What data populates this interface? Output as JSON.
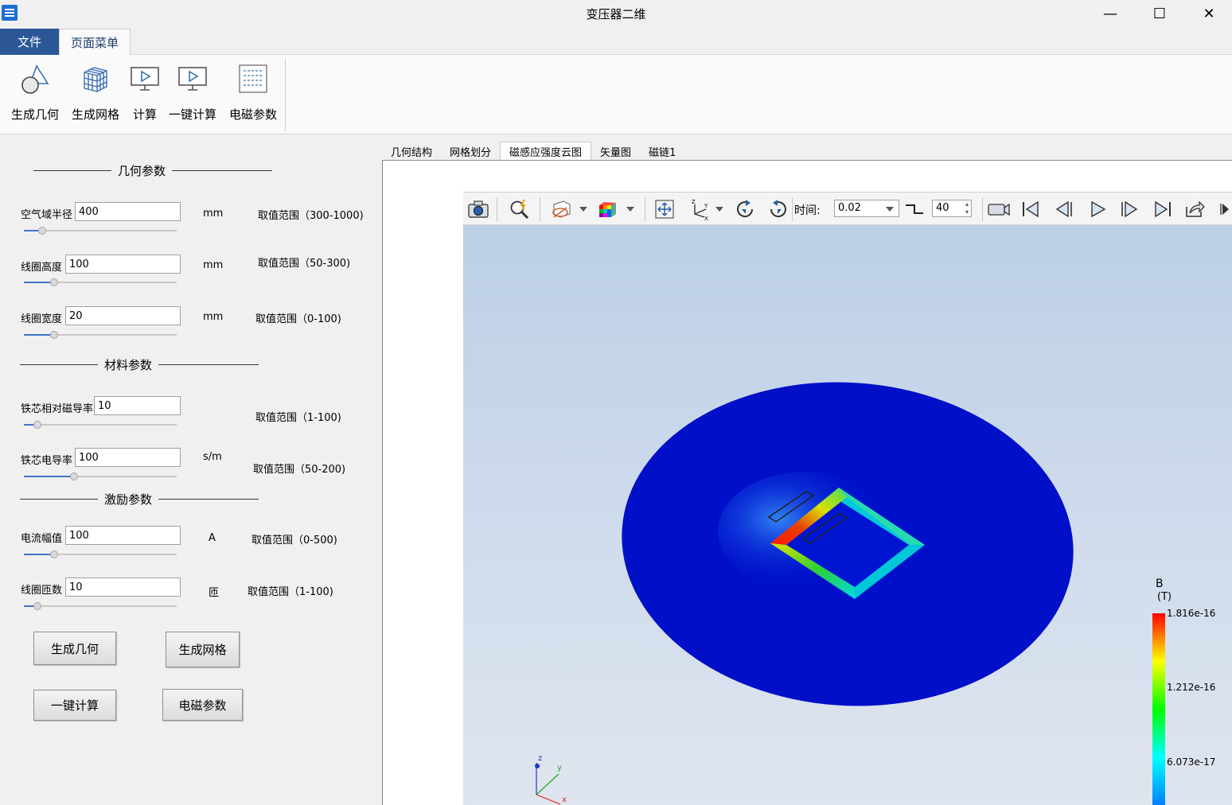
{
  "window": {
    "title": "变压器二维",
    "minimize": "—",
    "maximize": "☐",
    "close": "✕"
  },
  "menu": {
    "file": "文件",
    "page_menu": "页面菜单"
  },
  "ribbon": [
    {
      "label": "生成几何",
      "icon": "geometry-shapes-icon"
    },
    {
      "label": "生成网格",
      "icon": "mesh-cube-icon"
    },
    {
      "label": "计算",
      "icon": "compute-monitor-icon"
    },
    {
      "label": "一键计算",
      "icon": "one-click-compute-icon"
    },
    {
      "label": "电磁参数",
      "icon": "em-params-icon"
    }
  ],
  "panel": {
    "sections": {
      "geometry": "几何参数",
      "material": "材料参数",
      "excitation": "激励参数"
    },
    "params": [
      {
        "label": "空气域半径",
        "value": "400",
        "unit": "mm",
        "range": "取值范围（300-1000)",
        "slider_fraction": 0.12
      },
      {
        "label": "线圈高度",
        "value": "100",
        "unit": "mm",
        "range": "取值范围（50-300)",
        "slider_fraction": 0.2
      },
      {
        "label": "线圈宽度",
        "value": "20",
        "unit": "mm",
        "range": "取值范围（0-100)",
        "slider_fraction": 0.2
      },
      {
        "label": "铁芯相对磁导率",
        "value": "10",
        "unit": "",
        "range": "取值范围（1-100)",
        "slider_fraction": 0.09
      },
      {
        "label": "铁芯电导率",
        "value": "100",
        "unit": "s/m",
        "range": "取值范围（50-200)",
        "slider_fraction": 0.33
      },
      {
        "label": "电流幅值",
        "value": "100",
        "unit": "A",
        "range": "取值范围（0-500)",
        "slider_fraction": 0.2
      },
      {
        "label": "线圈匝数",
        "value": "10",
        "unit": "匝",
        "range": "取值范围（1-100)",
        "slider_fraction": 0.09
      }
    ],
    "buttons": {
      "gen_geometry": "生成几何",
      "gen_mesh": "生成网格",
      "one_click": "一键计算",
      "em_params": "电磁参数"
    }
  },
  "tabs": [
    "几何结构",
    "网格划分",
    "磁感应强度云图",
    "矢量图",
    "磁链1"
  ],
  "active_tab": 2,
  "toolbar": {
    "time_label": "时间:",
    "time_value": "0.02",
    "frame_value": "40",
    "icons": [
      "camera-icon",
      "zoom-lightning-icon",
      "hide-show-icon",
      "colormap-cube-icon",
      "fit-view-icon",
      "axis-orient-icon",
      "rotate-cw-icon",
      "rotate-ccw-icon",
      "frame-step-icon",
      "record-video-icon",
      "first-frame-icon",
      "prev-frame-icon",
      "play-icon",
      "next-frame-icon",
      "last-frame-icon",
      "export-icon",
      "more-icon"
    ]
  },
  "colorbar": {
    "title": "B",
    "unit": "(T)",
    "max": "1.816e-16",
    "mid": "1.212e-16",
    "low": "6.073e-17",
    "colors": [
      "#ff0000",
      "#ffff00",
      "#00ff00",
      "#00ffff",
      "#0080ff"
    ]
  },
  "axes": {
    "x": "x",
    "y": "y",
    "z": "z"
  }
}
